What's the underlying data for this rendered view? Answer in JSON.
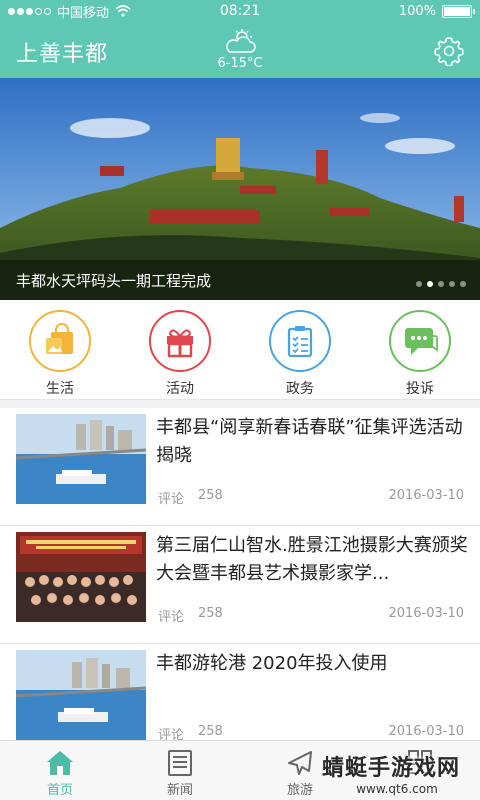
{
  "status_bar": {
    "carrier": "中国移动",
    "time": "08:21",
    "battery": "100%",
    "battery_level": 1.0
  },
  "header": {
    "title": "上善丰都",
    "weather_temp": "6-15°C",
    "weather_icon": "cloudy-icon",
    "settings_icon": "gear-icon"
  },
  "banner": {
    "caption": "丰都水天坪码头一期工程完成",
    "slide_count": 5,
    "active_slide": 2
  },
  "quick_nav": [
    {
      "label": "生活",
      "icon": "shopping-bag-icon",
      "color": "#f2b53a"
    },
    {
      "label": "活动",
      "icon": "gift-icon",
      "color": "#e0474c"
    },
    {
      "label": "政务",
      "icon": "clipboard-icon",
      "color": "#4aa3df"
    },
    {
      "label": "投诉",
      "icon": "chat-bubble-icon",
      "color": "#6cbf5e"
    }
  ],
  "news": [
    {
      "title": "丰都县“阅享新春话春联”征集评选活动揭晓",
      "comment_label": "评论",
      "comments": "258",
      "date": "2016-03-10"
    },
    {
      "title": "第三届仁山智水.胜景江池摄影大赛颁奖大会暨丰都县艺术摄影家学...",
      "comment_label": "评论",
      "comments": "258",
      "date": "2016-03-10"
    },
    {
      "title": "丰都游轮港 2020年投入使用",
      "comment_label": "评论",
      "comments": "258",
      "date": "2016-03-10"
    }
  ],
  "tabs": [
    {
      "label": "首页",
      "icon": "home-icon",
      "active": true
    },
    {
      "label": "新闻",
      "icon": "news-icon",
      "active": false
    },
    {
      "label": "旅游",
      "icon": "plane-icon",
      "active": false
    },
    {
      "label": "",
      "icon": "grid-icon",
      "active": false
    }
  ],
  "watermark": {
    "text": "蜻蜓手游戏网",
    "url": "www.qt6.com"
  },
  "colors": {
    "accent": "#5ec8b5",
    "tab_active": "#4cbba6"
  }
}
